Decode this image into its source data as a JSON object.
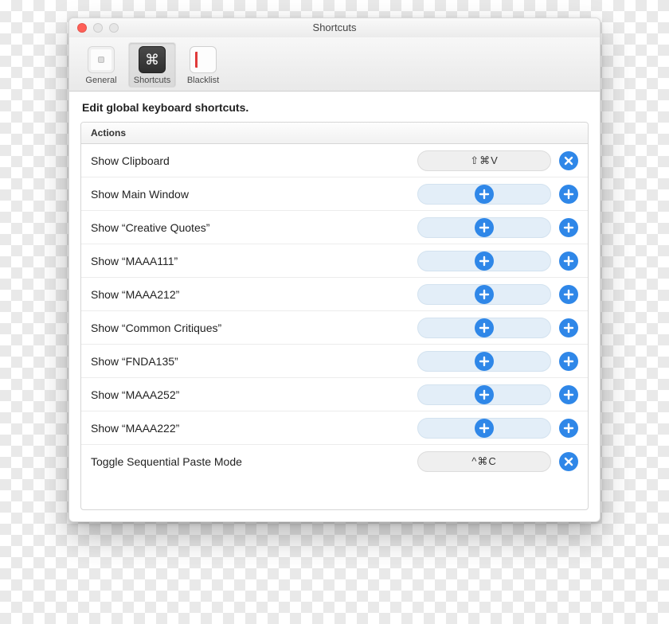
{
  "window": {
    "title": "Shortcuts"
  },
  "toolbar": {
    "items": [
      {
        "label": "General",
        "selected": false
      },
      {
        "label": "Shortcuts",
        "selected": true
      },
      {
        "label": "Blacklist",
        "selected": false
      }
    ]
  },
  "heading": "Edit global keyboard shortcuts.",
  "table": {
    "header": "Actions",
    "rows": [
      {
        "label": "Show Clipboard",
        "shortcut": "⇧⌘V",
        "assigned": true
      },
      {
        "label": "Show Main Window",
        "shortcut": "",
        "assigned": false
      },
      {
        "label": "Show “Creative Quotes”",
        "shortcut": "",
        "assigned": false
      },
      {
        "label": "Show “MAAA111”",
        "shortcut": "",
        "assigned": false
      },
      {
        "label": "Show “MAAA212”",
        "shortcut": "",
        "assigned": false
      },
      {
        "label": "Show “Common Critiques”",
        "shortcut": "",
        "assigned": false
      },
      {
        "label": "Show “FNDA135”",
        "shortcut": "",
        "assigned": false
      },
      {
        "label": "Show “MAAA252”",
        "shortcut": "",
        "assigned": false
      },
      {
        "label": "Show “MAAA222”",
        "shortcut": "",
        "assigned": false
      },
      {
        "label": "Toggle Sequential Paste Mode",
        "shortcut": "^⌘C",
        "assigned": true
      }
    ]
  },
  "icons": {
    "plus_title": "Add shortcut",
    "clear_title": "Clear shortcut"
  }
}
